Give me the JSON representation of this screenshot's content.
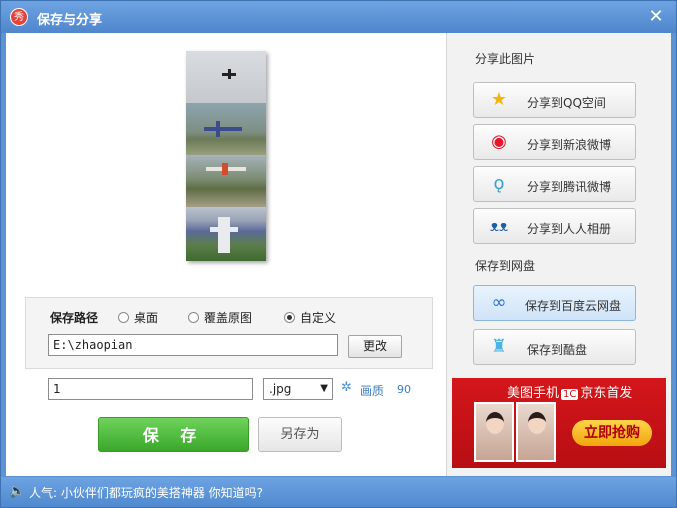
{
  "window": {
    "title": "保存与分享",
    "logo_text": "秀",
    "close_glyph": "✕"
  },
  "save_path": {
    "label": "保存路径",
    "options": [
      {
        "label": "桌面",
        "selected": false
      },
      {
        "label": "覆盖原图",
        "selected": false
      },
      {
        "label": "自定义",
        "selected": true
      }
    ],
    "path_value": "E:\\zhaopian",
    "change_button": "更改"
  },
  "file": {
    "name_value": "1",
    "extension": ".jpg",
    "quality_label": "画质",
    "quality_value": "90"
  },
  "actions": {
    "save": "保 存",
    "save_as": "另存为"
  },
  "share": {
    "section_label": "分享此图片",
    "buttons": [
      {
        "label": "分享到QQ空间",
        "icon": "qzone-star-icon"
      },
      {
        "label": "分享到新浪微博",
        "icon": "sina-weibo-icon"
      },
      {
        "label": "分享到腾讯微博",
        "icon": "tencent-weibo-icon"
      },
      {
        "label": "分享到人人相册",
        "icon": "renren-icon"
      }
    ]
  },
  "cloud": {
    "section_label": "保存到网盘",
    "buttons": [
      {
        "label": "保存到百度云网盘",
        "icon": "baidu-cloud-icon"
      },
      {
        "label": "保存到酷盘",
        "icon": "kupan-icon"
      }
    ]
  },
  "ad": {
    "title_part1": "美图手机",
    "badge": "1C",
    "title_part2": "京东首发",
    "cta": "立即抢购"
  },
  "status": {
    "text": "人气: 小伙伴们都玩疯的美搭神器 你知道吗?"
  },
  "colors": {
    "titlebar": "#5c93d4",
    "save_green": "#3aa72a",
    "link_blue": "#3b7ec2",
    "ad_red": "#c9151b"
  }
}
